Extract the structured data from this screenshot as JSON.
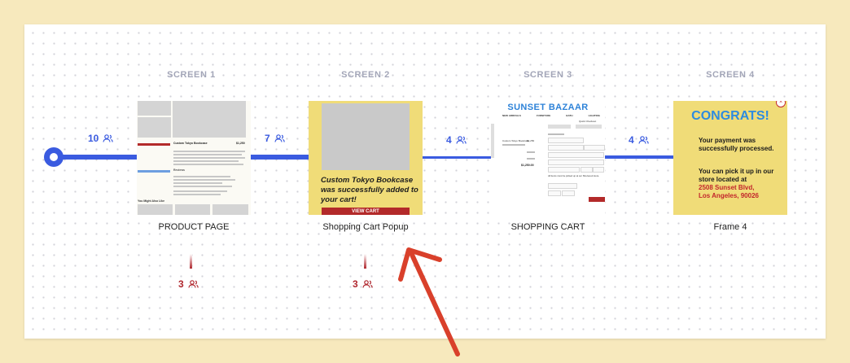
{
  "screens": [
    {
      "heading": "SCREEN 1",
      "name": "PRODUCT PAGE"
    },
    {
      "heading": "SCREEN 2",
      "name": "Shopping Cart Popup"
    },
    {
      "heading": "SCREEN 3",
      "name": "SHOPPING CART"
    },
    {
      "heading": "SCREEN 4",
      "name": "Frame 4"
    }
  ],
  "flow_counts": {
    "start": "10",
    "to_screen2": "7",
    "to_screen3": "4",
    "to_screen4": "4"
  },
  "drop_counts": {
    "screen1": "3",
    "screen2": "3"
  },
  "product_page": {
    "title": "Custom Tokyo Bookcase",
    "price": "$1,250",
    "section_label": "Reviews",
    "also_label": "You Might Also Like"
  },
  "popup": {
    "message": "Custom Tokyo Bookcase was successfully added to your cart!",
    "button": "VIEW CART"
  },
  "cart": {
    "brand": "SUNSET BAZAAR",
    "nav": [
      "NEW ARRIVALS",
      "FURNITURE",
      "BATH",
      "LIGHTING"
    ],
    "quick_checkout": "Quick Checkout",
    "item": "Custom Tokyo Bookcase",
    "item_price": "$1,250",
    "total": "$1,250.00",
    "pickup_note": "All items must be picked up at our Sherwood store."
  },
  "congrats": {
    "heading": "CONGRATS!",
    "line1": "Your payment was successfully processed.",
    "line2": "You can pick it up in our store located at",
    "address": "2508 Sunset Blvd, Los Angeles, 90026"
  },
  "colors": {
    "flow": "#3a5be0",
    "dropoff": "#b0282f",
    "accent_yellow": "#f0dc78",
    "brand_blue": "#2d82d8",
    "annotation_arrow": "#d9402b"
  },
  "icons": {
    "user_group": "users-icon",
    "start_node": "start-node-icon",
    "annotation": "arrow-annotation"
  }
}
